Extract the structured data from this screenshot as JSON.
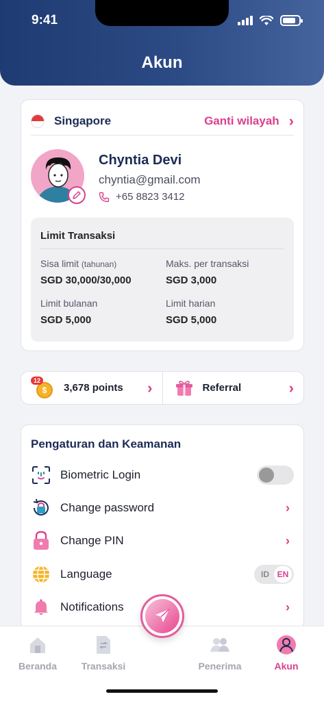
{
  "status_bar": {
    "time": "9:41"
  },
  "header": {
    "title": "Akun"
  },
  "region": {
    "name": "Singapore",
    "action_label": "Ganti wilayah"
  },
  "profile": {
    "name": "Chyntia Devi",
    "email": "chyntia@gmail.com",
    "phone": "+65 8823 3412"
  },
  "limits": {
    "title": "Limit Transaksi",
    "items": [
      {
        "label": "Sisa limit",
        "note": "(tahunan)",
        "value": "SGD 30,000/30,000"
      },
      {
        "label": "Maks. per transaksi",
        "note": "",
        "value": "SGD 3,000"
      },
      {
        "label": "Limit bulanan",
        "note": "",
        "value": "SGD 5,000"
      },
      {
        "label": "Limit harian",
        "note": "",
        "value": "SGD 5,000"
      }
    ]
  },
  "rewards": {
    "badge_count": "12",
    "points_label": "3,678 points",
    "referral_label": "Referral"
  },
  "settings": {
    "title": "Pengaturan dan Keamanan",
    "items": [
      {
        "label": "Biometric Login",
        "icon": "face-id-icon",
        "control": "toggle",
        "on": false
      },
      {
        "label": "Change password",
        "icon": "lock-refresh-icon",
        "control": "chevron"
      },
      {
        "label": "Change PIN",
        "icon": "padlock-icon",
        "control": "chevron"
      },
      {
        "label": "Language",
        "icon": "globe-icon",
        "control": "language"
      },
      {
        "label": "Notifications",
        "icon": "bell-icon",
        "control": "chevron"
      }
    ],
    "language_options": [
      "ID",
      "EN"
    ],
    "language_selected": "EN"
  },
  "tabbar": {
    "items": [
      {
        "label": "Beranda",
        "icon": "home-icon"
      },
      {
        "label": "Transaksi",
        "icon": "transaction-icon"
      },
      {
        "label": "Penerima",
        "icon": "recipients-icon"
      },
      {
        "label": "Akun",
        "icon": "account-icon",
        "active": true
      }
    ]
  },
  "colors": {
    "brand_pink": "#d9418d",
    "brand_navy": "#1c2b55",
    "header_blue": "#1f3b73"
  }
}
